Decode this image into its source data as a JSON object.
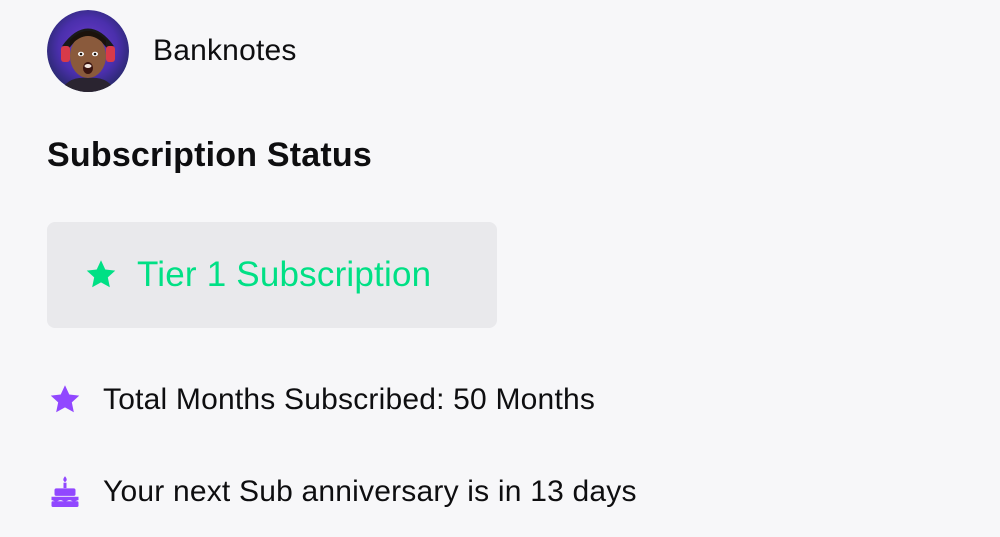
{
  "channel": {
    "name": "Banknotes",
    "avatar_icon": "user-avatar"
  },
  "section": {
    "title": "Subscription Status"
  },
  "tier": {
    "icon": "star-icon",
    "label": "Tier 1 Subscription",
    "color": "#00e085"
  },
  "stats": {
    "total_months": {
      "icon": "star-icon",
      "text": "Total Months Subscribed: 50 Months",
      "color": "#9147ff"
    },
    "anniversary": {
      "icon": "cake-icon",
      "text": "Your next Sub anniversary is in 13 days",
      "color": "#9147ff"
    }
  },
  "colors": {
    "background": "#f7f7f9",
    "badge_background": "#e9e9ec",
    "text": "#0e0e10"
  }
}
